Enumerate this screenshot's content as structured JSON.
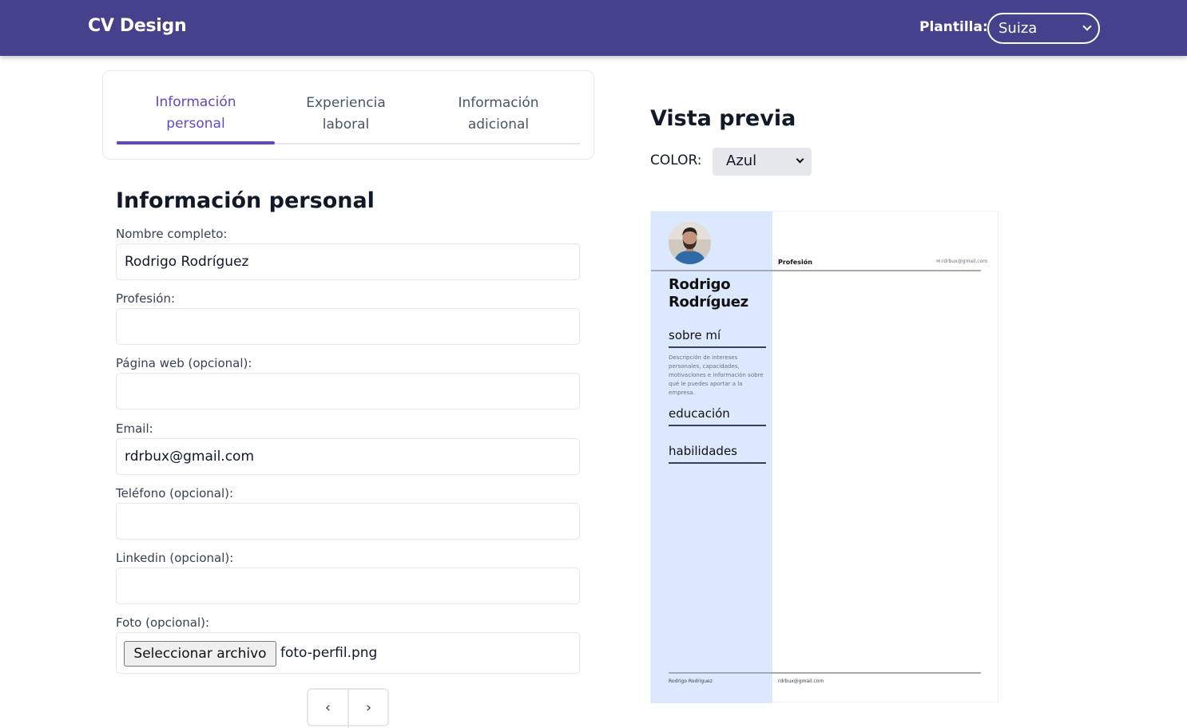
{
  "header": {
    "brand": "CV Design",
    "template_label": "Plantilla:",
    "template_value": "Suiza"
  },
  "tabs": [
    {
      "label_line1": "Información",
      "label_line2": "personal",
      "active": true
    },
    {
      "label_line1": "Experiencia",
      "label_line2": "laboral",
      "active": false
    },
    {
      "label_line1": "Información",
      "label_line2": "adicional",
      "active": false
    }
  ],
  "form": {
    "title": "Información personal",
    "fields": {
      "full_name": {
        "label": "Nombre completo:",
        "value": "Rodrigo Rodríguez"
      },
      "profession": {
        "label": "Profesión:",
        "value": ""
      },
      "website": {
        "label": "Página web (opcional):",
        "value": ""
      },
      "email": {
        "label": "Email:",
        "value": "rdrbux@gmail.com"
      },
      "phone": {
        "label": "Teléfono (opcional):",
        "value": ""
      },
      "linkedin": {
        "label": "Linkedin (opcional):",
        "value": ""
      },
      "photo": {
        "label": "Foto (opcional):",
        "button": "Seleccionar archivo",
        "file_name": "foto-perfil.png"
      }
    },
    "pager": {
      "prev": "‹",
      "next": "›"
    }
  },
  "preview": {
    "title": "Vista previa",
    "color_label": "COLOR:",
    "color_value": "Azul",
    "cv": {
      "name_line1": "Rodrigo",
      "name_line2": "Rodríguez",
      "profession": "Profesión",
      "email": "✉ rdrbux@gmail.com",
      "about_title": "sobre mí",
      "about_text": "Descripción de intereses personales, capacidades, motivaciones e información sobre qué le puedes aportar a la empresa.",
      "education_title": "educación",
      "skills_title": "habilidades",
      "footer_name": "Rodrigo Rodríguez",
      "footer_email": "rdrbux@gmail.com",
      "side_color": "#dbe8fe"
    }
  },
  "colors": {
    "header_bg": "#45418c",
    "accent": "#5b4bc4"
  }
}
